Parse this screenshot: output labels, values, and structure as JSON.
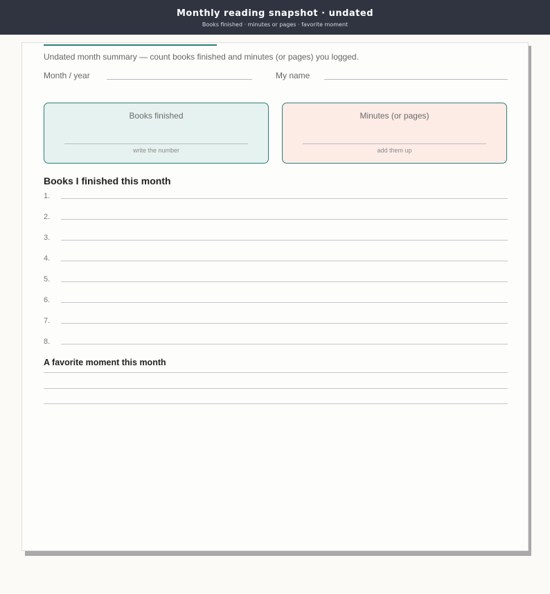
{
  "header": {
    "title": "Monthly reading snapshot · undated",
    "subtitle": "Books finished · minutes or pages · favorite moment"
  },
  "sheet": {
    "intro": "Undated month summary — count books finished and minutes (or pages) you logged.",
    "month_year_label": "Month / year",
    "name_label": "My name",
    "boxes": [
      {
        "label": "Books finished",
        "hint": "write the number"
      },
      {
        "label": "Minutes (or pages)",
        "hint": "add them up"
      }
    ],
    "books_heading": "Books I finished this month",
    "book_numbers": [
      "1.",
      "2.",
      "3.",
      "4.",
      "5.",
      "6.",
      "7.",
      "8."
    ],
    "moment_heading": "A favorite moment this month"
  },
  "colors": {
    "header_bg": "#2f3440",
    "accent": "#2f7d78",
    "books_box_bg": "#e6f2ef",
    "minutes_box_bg": "#fdebe6"
  }
}
